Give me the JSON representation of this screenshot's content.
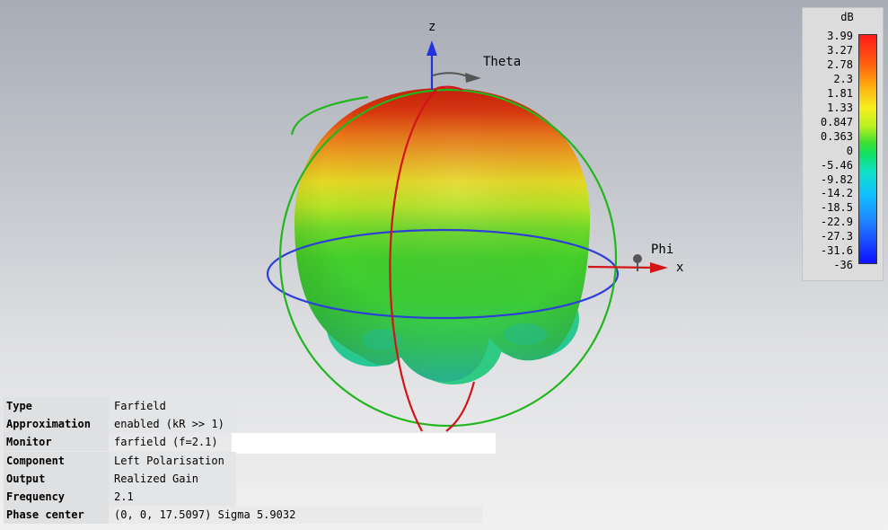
{
  "plot": {
    "axis_z": "z",
    "axis_x": "x",
    "theta_label": "Theta",
    "phi_label": "Phi"
  },
  "legend": {
    "unit": "dB",
    "ticks": [
      "3.99",
      "3.27",
      "2.78",
      "2.3",
      "1.81",
      "1.33",
      "0.847",
      "0.363",
      "0",
      "-5.46",
      "-9.82",
      "-14.2",
      "-18.5",
      "-22.9",
      "-27.3",
      "-31.6",
      "-36"
    ],
    "colors": {
      "max": "#ff1a1a",
      "mid": "#10e060",
      "min": "#1010ff"
    }
  },
  "info": [
    {
      "key": "Type",
      "value": "Farfield"
    },
    {
      "key": "Approximation",
      "value": "enabled (kR >> 1)"
    },
    {
      "key": "Monitor",
      "value": "farfield (f=2.1)"
    },
    {
      "key": "Component",
      "value": "Left Polarisation"
    },
    {
      "key": "Output",
      "value": "Realized Gain"
    },
    {
      "key": "Frequency",
      "value": "2.1"
    },
    {
      "key": "Phase center",
      "value": "(0, 0, 17.5097) Sigma 5.9032"
    }
  ]
}
